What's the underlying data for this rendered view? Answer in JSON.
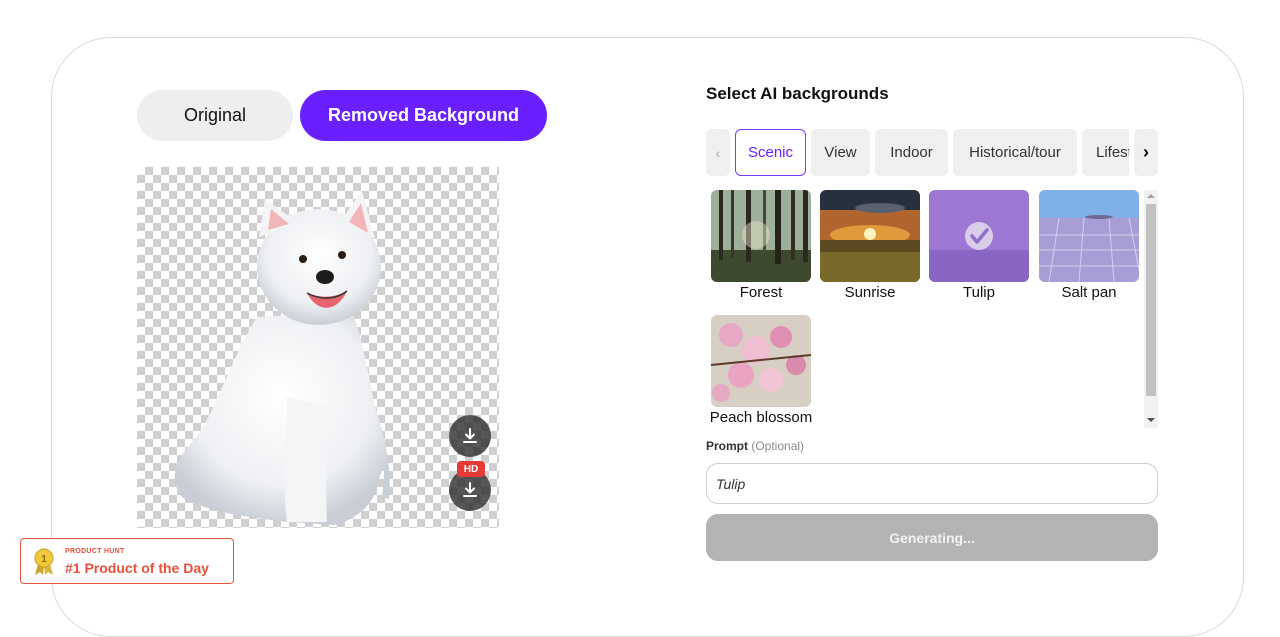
{
  "toggle": {
    "original_label": "Original",
    "removed_label": "Removed Background",
    "active": "Removed Background"
  },
  "preview": {
    "subject": "white puppy with transparent background",
    "download_icon": "download-icon",
    "hd_badge": "HD"
  },
  "product_hunt": {
    "small_text": "PRODUCT HUNT",
    "title": "#1 Product of the Day",
    "medal_number": "1",
    "color": "#e8503a"
  },
  "backgrounds": {
    "title": "Select AI backgrounds",
    "tabs": [
      {
        "label": "Scenic",
        "active": true
      },
      {
        "label": "View",
        "active": false
      },
      {
        "label": "Indoor",
        "active": false
      },
      {
        "label": "Historical/tour",
        "active": false
      },
      {
        "label": "Lifestyle",
        "active": false
      }
    ],
    "thumbnails": [
      {
        "label": "Forest",
        "selected": false
      },
      {
        "label": "Sunrise",
        "selected": false
      },
      {
        "label": "Tulip",
        "selected": true
      },
      {
        "label": "Salt pan",
        "selected": false
      },
      {
        "label": "Peach blossom",
        "selected": false
      }
    ]
  },
  "prompt": {
    "label": "Prompt",
    "optional": "(Optional)",
    "value": "Tulip"
  },
  "generate": {
    "label": "Generating..."
  },
  "colors": {
    "accent": "#6a1fff",
    "disabled_button": "#b3b3b3",
    "product_hunt": "#e8503a"
  }
}
